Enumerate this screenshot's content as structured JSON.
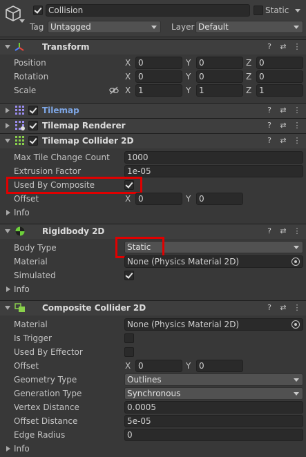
{
  "gameobject": {
    "name": "Collision",
    "static_label": "Static",
    "tag_label": "Tag",
    "tag_value": "Untagged",
    "layer_label": "Layer",
    "layer_value": "Default"
  },
  "transform": {
    "title": "Transform",
    "position_label": "Position",
    "rotation_label": "Rotation",
    "scale_label": "Scale",
    "x": "X",
    "y": "Y",
    "z": "Z",
    "position": [
      "0",
      "0",
      "0"
    ],
    "rotation": [
      "0",
      "0",
      "0"
    ],
    "scale": [
      "1",
      "1",
      "1"
    ]
  },
  "tilemap": {
    "title": "Tilemap"
  },
  "tilemap_renderer": {
    "title": "Tilemap Renderer"
  },
  "tilemap_collider": {
    "title": "Tilemap Collider 2D",
    "max_tile_label": "Max Tile Change Count",
    "max_tile_value": "1000",
    "extrusion_label": "Extrusion Factor",
    "extrusion_value": "1e-05",
    "used_by_composite_label": "Used By Composite",
    "offset_label": "Offset",
    "offset_x": "0",
    "offset_y": "0",
    "info_label": "Info"
  },
  "rigidbody": {
    "title": "Rigidbody 2D",
    "body_type_label": "Body Type",
    "body_type_value": "Static",
    "material_label": "Material",
    "material_value": "None (Physics Material 2D)",
    "simulated_label": "Simulated",
    "info_label": "Info"
  },
  "composite": {
    "title": "Composite Collider 2D",
    "material_label": "Material",
    "material_value": "None (Physics Material 2D)",
    "is_trigger_label": "Is Trigger",
    "used_by_effector_label": "Used By Effector",
    "offset_label": "Offset",
    "offset_x": "0",
    "offset_y": "0",
    "geometry_label": "Geometry Type",
    "geometry_value": "Outlines",
    "generation_label": "Generation Type",
    "generation_value": "Synchronous",
    "vertex_label": "Vertex Distance",
    "vertex_value": "0.0005",
    "offset_distance_label": "Offset Distance",
    "offset_distance_value": "5e-05",
    "edge_radius_label": "Edge Radius",
    "edge_radius_value": "0",
    "info_label": "Info"
  },
  "header_icons": {
    "help": "?",
    "preset": "⇄",
    "menu": "⋮"
  },
  "colors": {
    "highlight_box": "#e00000",
    "tilemap_title": "#7ea7e6",
    "panel_bg": "#383838"
  }
}
